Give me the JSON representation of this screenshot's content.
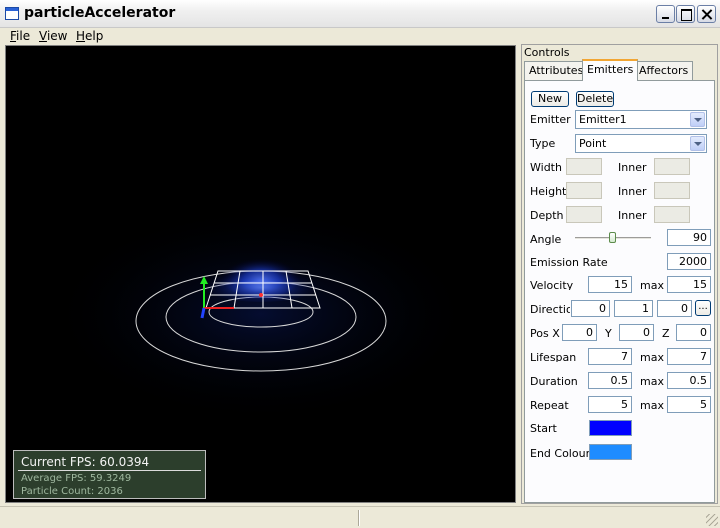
{
  "window": {
    "title": "particleAccelerator"
  },
  "menu": [
    "File",
    "View",
    "Help"
  ],
  "overlay": {
    "current_fps": "Current  FPS: 60.0394",
    "average_fps": "Average  FPS: 59.3249",
    "particle_count": "Particle  Count: 2036"
  },
  "dock": {
    "title": "Controls",
    "tabs": [
      "Attributes",
      "Emitters",
      "Affectors"
    ],
    "active_tab": "Emitters",
    "new_label": "New",
    "delete_label": "Delete",
    "emitter": {
      "label": "Emitter",
      "value": "Emitter1"
    },
    "type": {
      "label": "Type",
      "value": "Point"
    },
    "width_label": "Width",
    "height_label": "Height",
    "depth_label": "Depth",
    "inner_label": "Inner",
    "angle": {
      "label": "Angle",
      "value": "90",
      "slider_fraction": 0.5
    },
    "emission_rate": {
      "label": "Emission Rate",
      "value": "2000"
    },
    "max_label": "max",
    "velocity": {
      "label": "Velocity",
      "min": "15",
      "max": "15"
    },
    "direction": {
      "label": "Direction",
      "x": "0",
      "y": "1",
      "z": "0",
      "button": "..."
    },
    "position": {
      "x_label": "Pos X",
      "y_label": "Y",
      "z_label": "Z",
      "x": "0",
      "y": "0",
      "z": "0"
    },
    "lifespan": {
      "label": "Lifespan",
      "min": "7",
      "max": "7"
    },
    "duration": {
      "label": "Duration",
      "min": "0.5",
      "max": "0.5"
    },
    "repeat": {
      "label": "Repeat",
      "min": "5",
      "max": "5"
    },
    "start_colour": {
      "label": "Start Colour",
      "color": "#0000ff"
    },
    "end_colour": {
      "label": "End Colour",
      "color": "#1e8cff"
    }
  }
}
